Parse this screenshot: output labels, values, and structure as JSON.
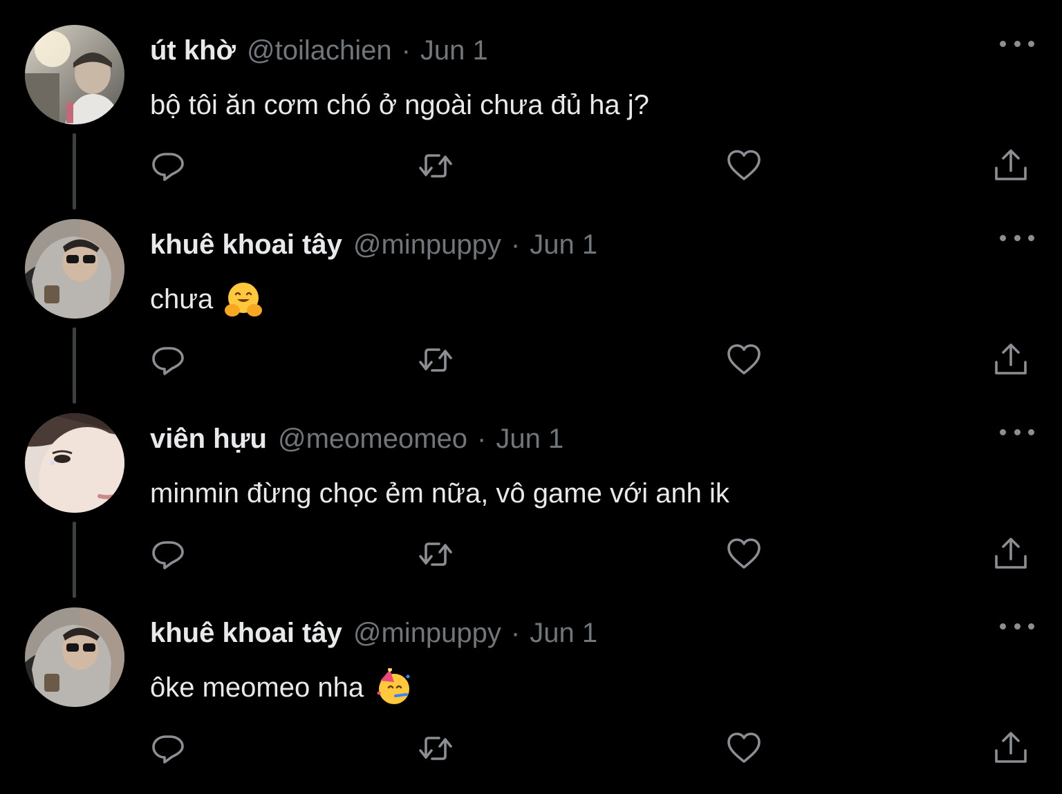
{
  "tweets": [
    {
      "name": "út khờ",
      "handle": "@toilachien",
      "separator": "·",
      "date": "Jun 1",
      "text": "bộ tôi ăn cơm chó ở ngoài chưa đủ ha j?",
      "emoji": "",
      "avatar": "avatar-selfie-sunlight"
    },
    {
      "name": "khuê khoai tây",
      "handle": "@minpuppy",
      "separator": "·",
      "date": "Jun 1",
      "text": "chưa",
      "emoji": "hugging-face-emoji",
      "avatar": "avatar-grey-hoodie-sunglasses"
    },
    {
      "name": "viên hựu",
      "handle": "@meomeomeo",
      "separator": "·",
      "date": "Jun 1",
      "text": "minmin đừng chọc ẻm nữa, vô game với anh ik",
      "emoji": "",
      "avatar": "avatar-closeup-face"
    },
    {
      "name": "khuê khoai tây",
      "handle": "@minpuppy",
      "separator": "·",
      "date": "Jun 1",
      "text": "ôke meomeo nha",
      "emoji": "partying-face-emoji",
      "avatar": "avatar-grey-hoodie-sunglasses"
    }
  ],
  "icons": {
    "reply": "reply-icon",
    "retweet": "retweet-icon",
    "like": "like-icon",
    "share": "share-icon",
    "more": "more-icon"
  },
  "colors": {
    "background": "#000000",
    "primary_text": "#e7e9ea",
    "secondary_text": "#71767b",
    "icon": "#8b8f93",
    "thread_line": "#3e4144"
  }
}
